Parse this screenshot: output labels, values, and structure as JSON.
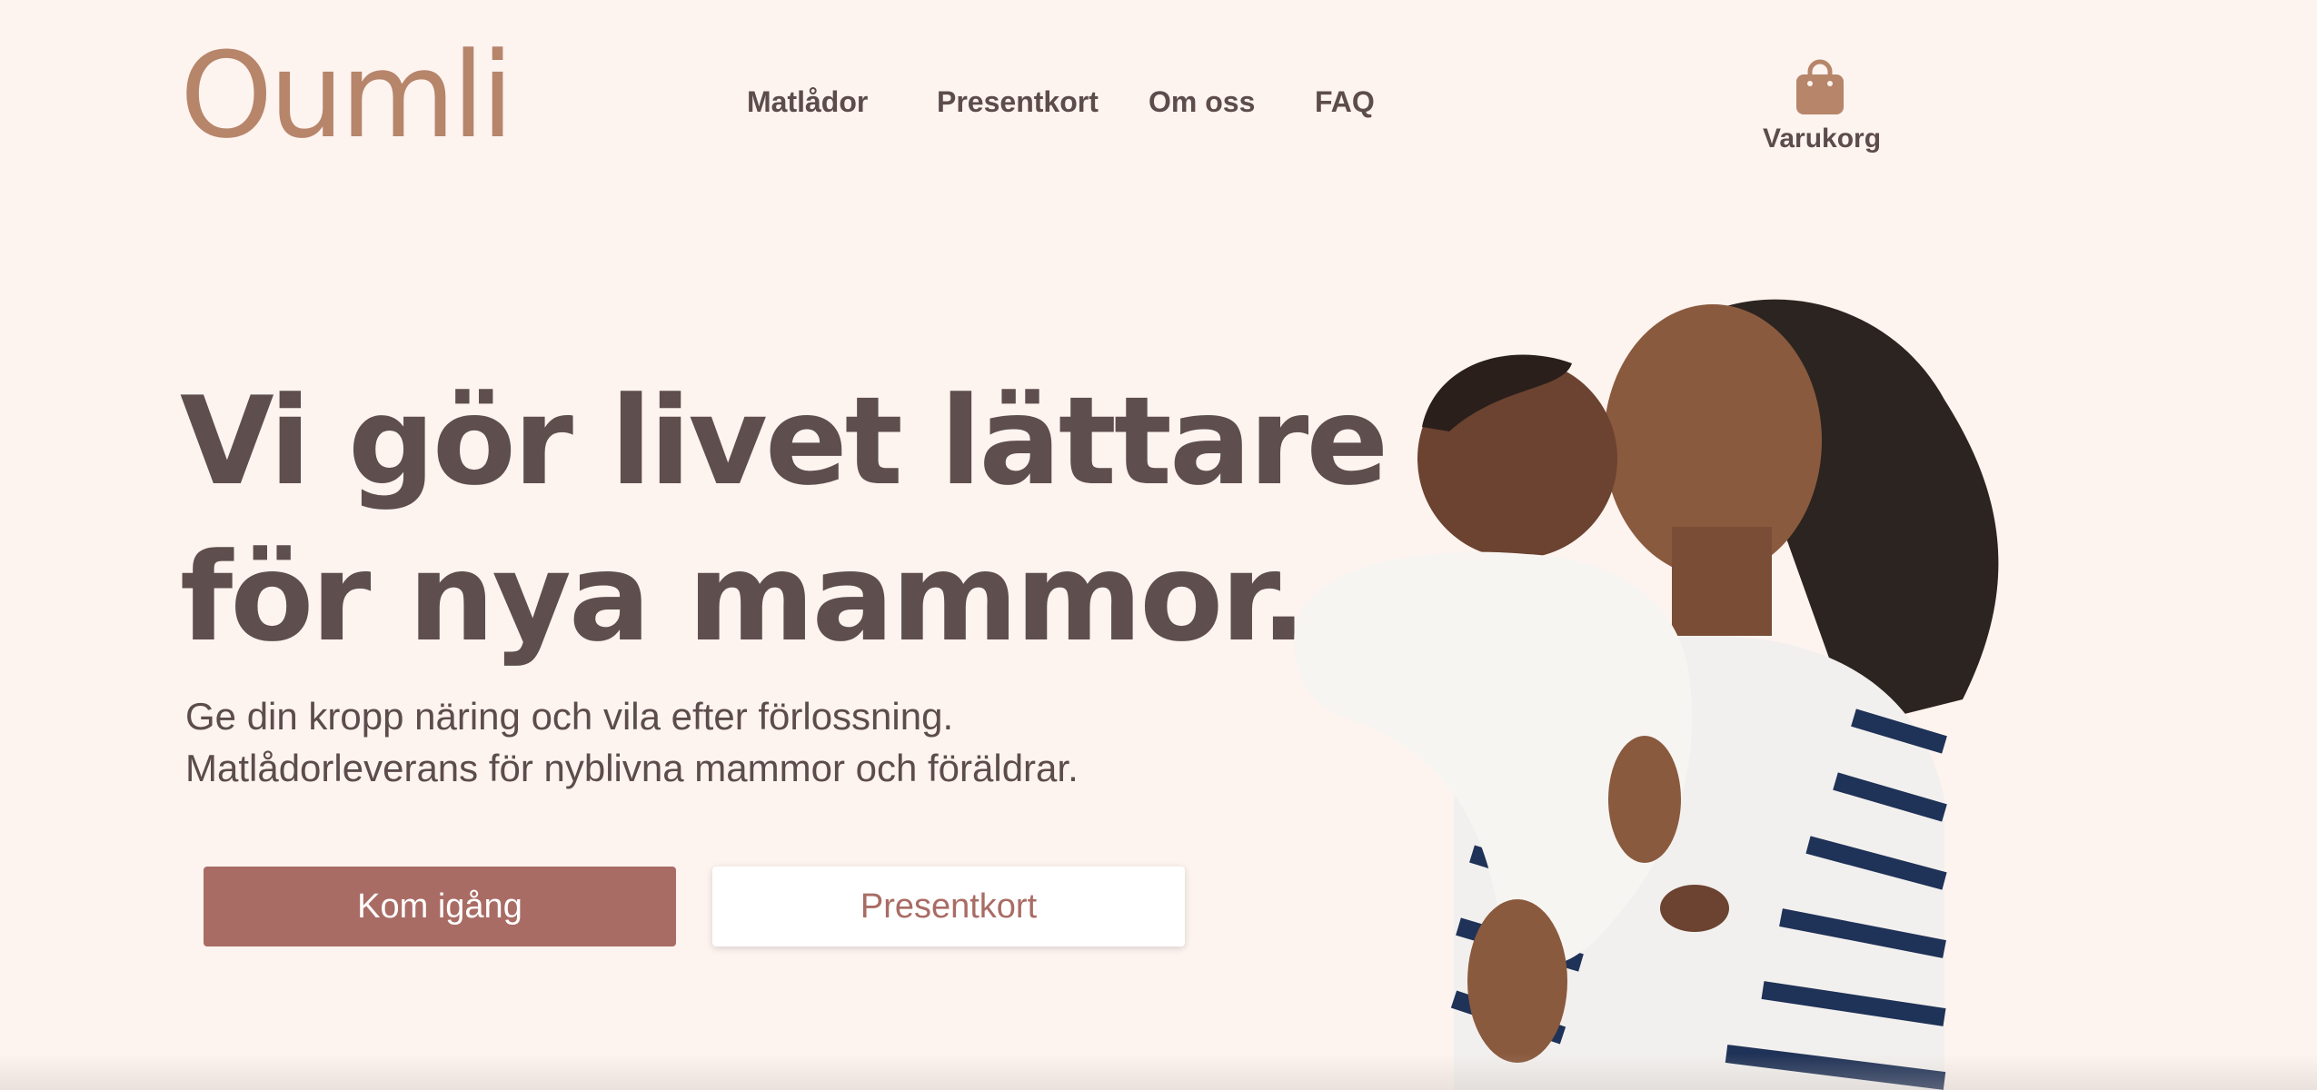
{
  "brand": {
    "logo_text": "Oumli"
  },
  "nav": {
    "items": [
      {
        "label": "Matlådor"
      },
      {
        "label": "Presentkort"
      },
      {
        "label": "Om oss"
      },
      {
        "label": "FAQ"
      }
    ]
  },
  "cart": {
    "label": "Varukorg",
    "icon": "shopping-bag-icon"
  },
  "hero": {
    "headline_line1": "Vi gör livet lättare",
    "headline_line2": "för nya mammor.",
    "subtext_line1": "Ge din kropp näring och vila efter förlossning.",
    "subtext_line2": "Matlådorleverans för nyblivna mammor och föräldrar.",
    "primary_button": "Kom igång",
    "secondary_button": "Presentkort"
  },
  "colors": {
    "background": "#fdf3ef",
    "brand": "#b6856a",
    "text": "#5e4e4e",
    "accent": "#a96c65"
  }
}
